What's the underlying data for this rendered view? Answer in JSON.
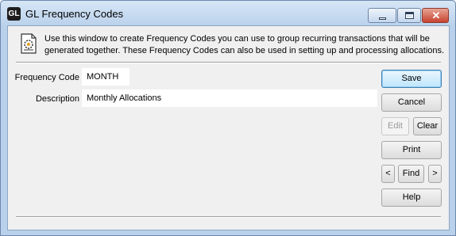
{
  "window": {
    "icon_text": "GL",
    "title": "GL Frequency Codes",
    "close_glyph": "✕"
  },
  "info": {
    "icon": "document-settings-icon",
    "text": "Use this window to create Frequency Codes you can use to group recurring transactions that will be generated together. These Frequency Codes can also be used in setting up and processing allocations."
  },
  "form": {
    "frequency_code_label": "Frequency Code",
    "frequency_code_value": "MONTH",
    "description_label": "Description",
    "description_value": "Monthly Allocations"
  },
  "buttons": {
    "save": "Save",
    "cancel": "Cancel",
    "edit": "Edit",
    "clear": "Clear",
    "print": "Print",
    "prev": "<",
    "find": "Find",
    "next": ">",
    "help": "Help"
  },
  "colors": {
    "frame": "#b9d1ea",
    "client": "#f0f0f0",
    "default_button_border": "#3c7fb1",
    "close_button": "#c7432f"
  }
}
